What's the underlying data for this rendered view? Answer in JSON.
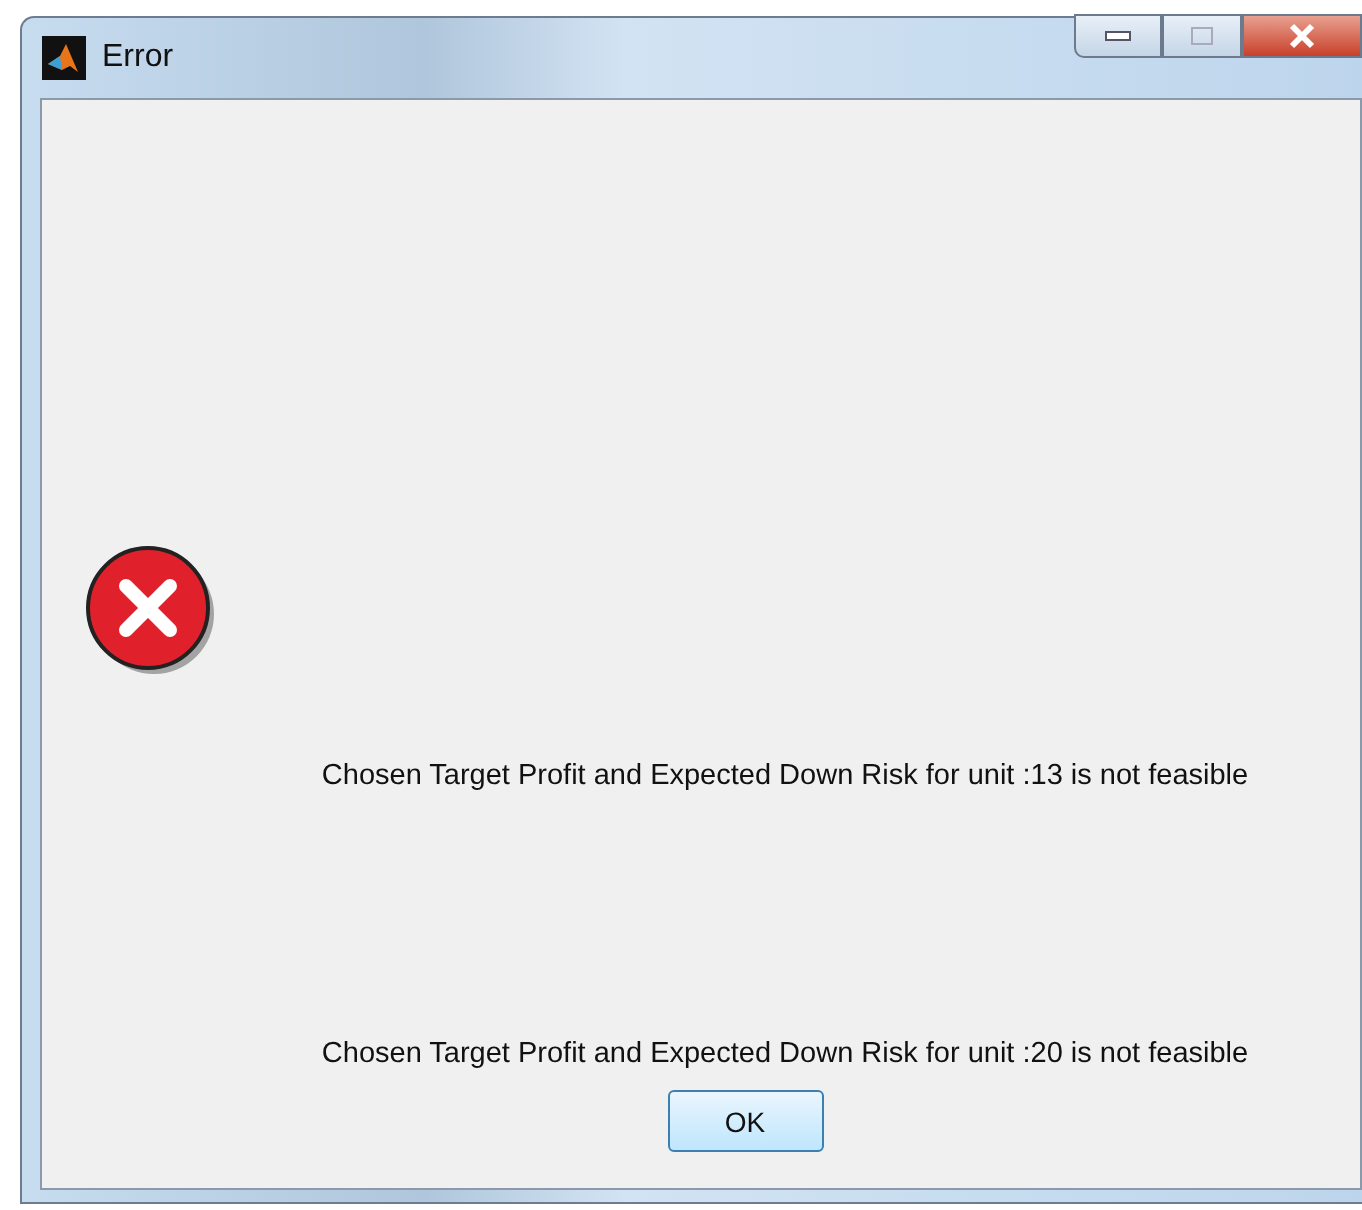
{
  "window": {
    "title": "Error"
  },
  "messages": [
    "Chosen Target Profit and Expected Down Risk for unit :13 is not feasible",
    "Chosen Target Profit and Expected Down Risk for unit :20 is not feasible"
  ],
  "buttons": [
    "OK"
  ]
}
